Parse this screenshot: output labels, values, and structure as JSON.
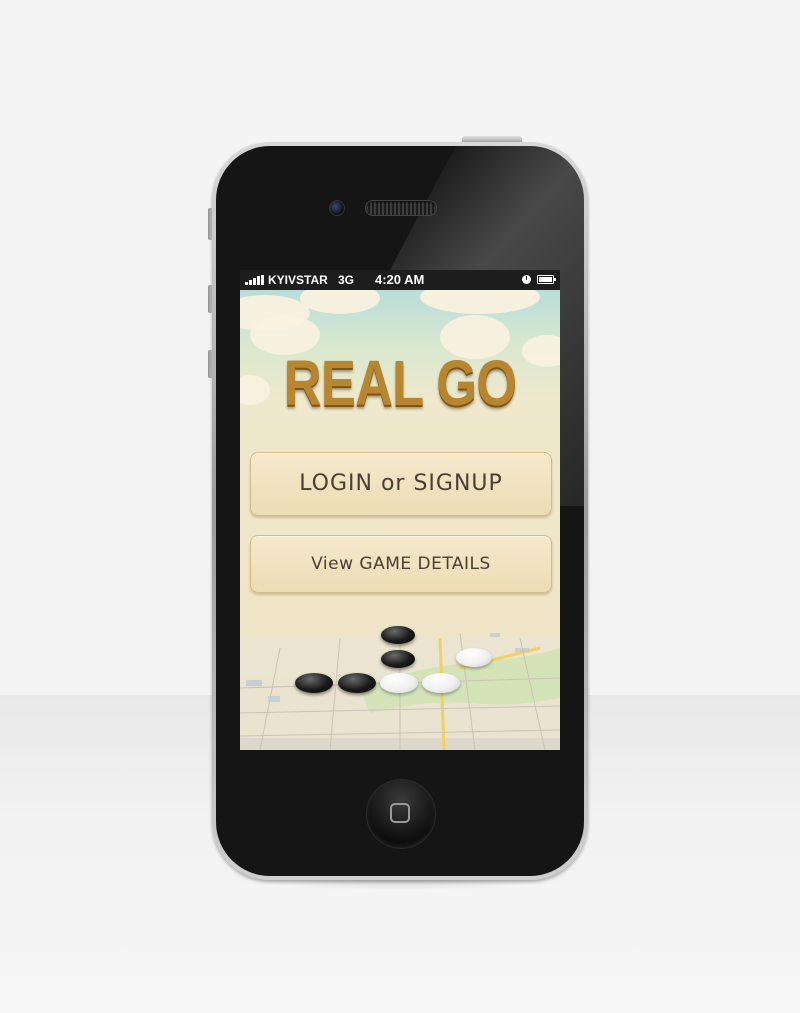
{
  "status_bar": {
    "carrier": "KYIVSTAR",
    "network": "3G",
    "time": "4:20 AM"
  },
  "app": {
    "title": "REAL GO",
    "login_button_label": "LOGIN or SIGNUP",
    "details_button_label": "View GAME DETAILS"
  },
  "board_stones": [
    "black",
    "black",
    "black",
    "black",
    "white",
    "white",
    "white"
  ],
  "icons": [
    "signal-bars-icon",
    "alarm-clock-icon",
    "battery-icon",
    "home-square-icon"
  ],
  "colors": {
    "title_gold": "#b8862e",
    "button_paper": "#f2e4c2",
    "button_text": "#4a3e33",
    "sky": "#b9dcd9"
  }
}
